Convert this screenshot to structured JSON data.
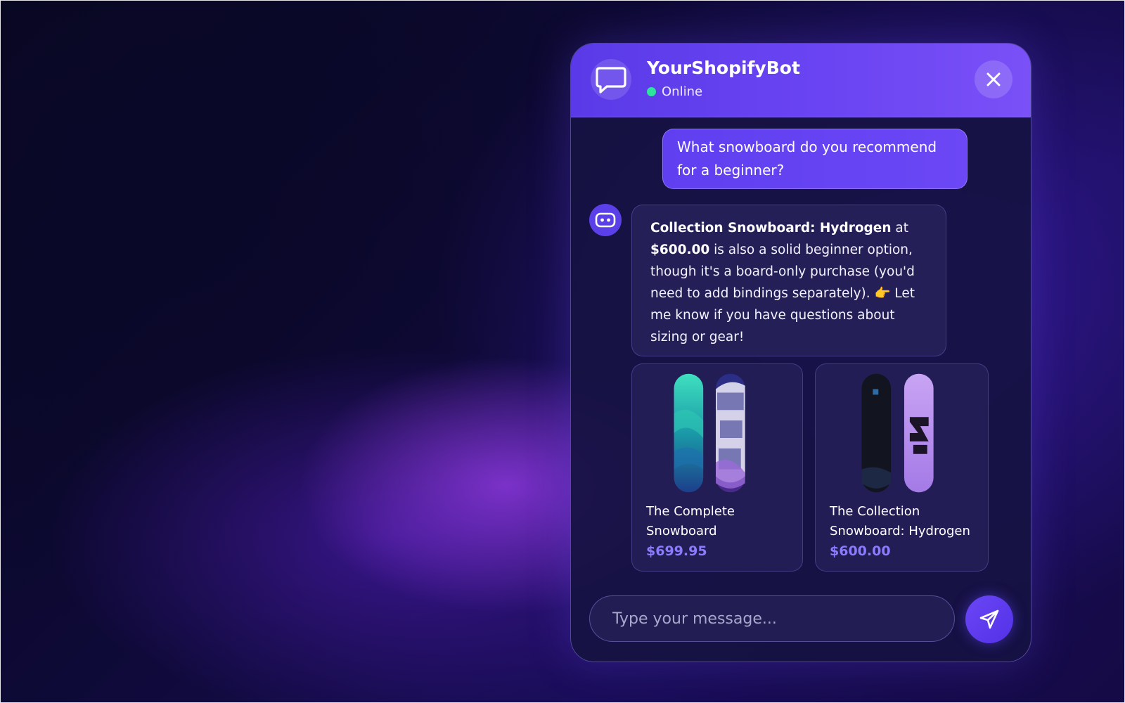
{
  "colors": {
    "accent": "#6a44f2",
    "online": "#2ee59d",
    "price": "#8a7bff",
    "panel": "#16124a"
  },
  "header": {
    "bot_name": "YourShopifyBot",
    "status": "Online",
    "avatar_icon": "chat-bubble-icon",
    "close_icon": "close-icon"
  },
  "messages": {
    "user": {
      "line1": "What snowboard do you recommend",
      "line2": "for a beginner?"
    },
    "assistant": {
      "avatar_icon": "robot-icon",
      "product_name": "Collection Snowboard: Hydrogen",
      "at": " at",
      "price": "$600.00",
      "text": " is also a solid beginner option, though it's a board-only purchase (you'd need to add bindings separately). 👉 Let me know if you have questions about sizing or gear!"
    }
  },
  "products": [
    {
      "title": "The Complete Snowboard",
      "price": "$699.95"
    },
    {
      "title": "The Collection Snowboard: Hydrogen",
      "price": "$600.00"
    }
  ],
  "composer": {
    "placeholder": "Type your message...",
    "send_icon": "send-icon"
  }
}
